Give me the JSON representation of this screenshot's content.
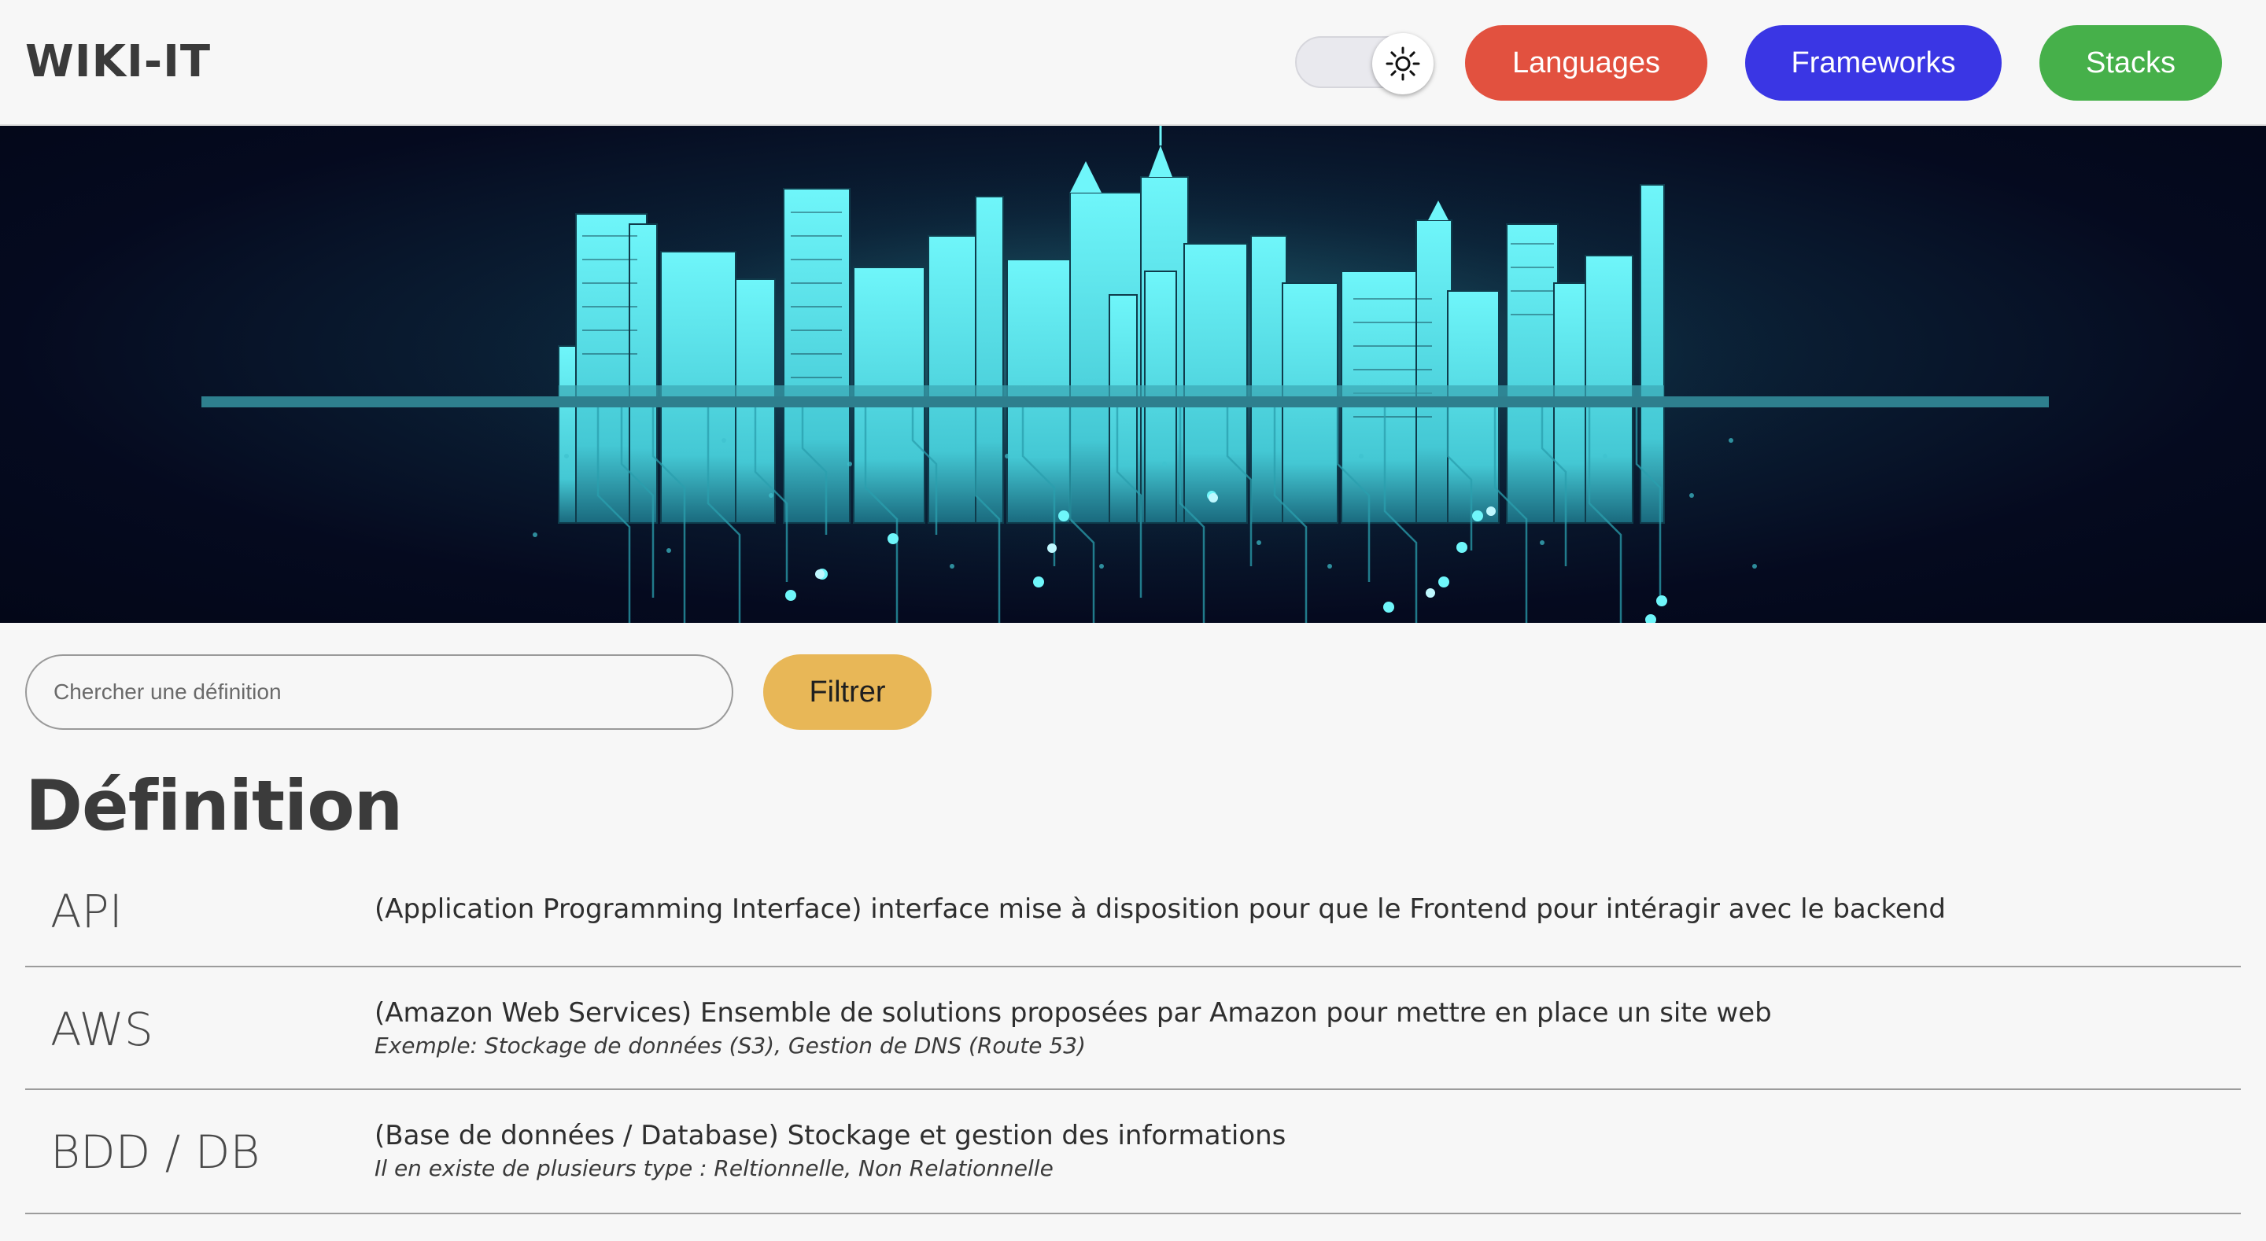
{
  "header": {
    "logo": "WIKI-IT",
    "theme_toggle_icon": "sun-icon",
    "nav": {
      "languages": "Languages",
      "frameworks": "Frameworks",
      "stacks": "Stacks"
    }
  },
  "colors": {
    "languages": "#e2513f",
    "frameworks": "#3a36e4",
    "stacks": "#46b04a",
    "filter": "#e8b757",
    "banner_accent": "#5ef0f5"
  },
  "search": {
    "placeholder": "Chercher une définition",
    "value": "",
    "filter_label": "Filtrer"
  },
  "main": {
    "title": "Définition",
    "definitions": [
      {
        "term": "API",
        "description": "(Application Programming Interface) interface mise à disposition pour que le Frontend pour intéragir avec le backend",
        "example": ""
      },
      {
        "term": "AWS",
        "description": "(Amazon Web Services) Ensemble de solutions proposées par Amazon pour mettre en place un site web",
        "example": "Exemple: Stockage de données (S3), Gestion de DNS (Route 53)"
      },
      {
        "term": "BDD / DB",
        "description": "(Base de données / Database) Stockage et gestion des informations",
        "example": "Il en existe de plusieurs type : Reltionnelle, Non Relationnelle"
      }
    ]
  }
}
